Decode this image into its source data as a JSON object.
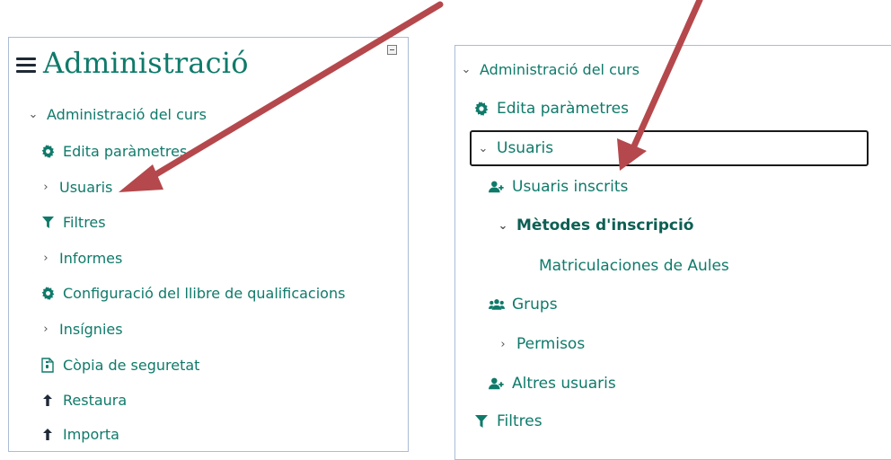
{
  "left_panel": {
    "title": "Administració",
    "items": [
      {
        "label": "Administració del curs",
        "icon": "chevron-down-icon"
      },
      {
        "label": "Edita paràmetres",
        "icon": "gear-icon"
      },
      {
        "label": "Usuaris",
        "icon": "chevron-right-icon"
      },
      {
        "label": "Filtres",
        "icon": "filter-icon"
      },
      {
        "label": "Informes",
        "icon": "chevron-right-icon"
      },
      {
        "label": "Configuració del llibre de qualificacions",
        "icon": "gear-icon"
      },
      {
        "label": "Insígnies",
        "icon": "chevron-right-icon"
      },
      {
        "label": "Còpia de seguretat",
        "icon": "file-archive-icon"
      },
      {
        "label": "Restaura",
        "icon": "upload-icon"
      },
      {
        "label": "Importa",
        "icon": "upload-icon"
      }
    ]
  },
  "right_panel": {
    "items": [
      {
        "label": "Administració del curs",
        "icon": "chevron-down-icon"
      },
      {
        "label": "Edita paràmetres",
        "icon": "gear-icon"
      },
      {
        "label": "Usuaris",
        "icon": "chevron-down-icon"
      },
      {
        "label": "Usuaris inscrits",
        "icon": "user-plus-icon"
      },
      {
        "label": "Mètodes d'inscripció",
        "icon": "chevron-down-icon"
      },
      {
        "label": "Matriculaciones de Aules",
        "icon": ""
      },
      {
        "label": "Grups",
        "icon": "users-icon"
      },
      {
        "label": "Permisos",
        "icon": "chevron-right-icon"
      },
      {
        "label": "Altres usuaris",
        "icon": "user-plus-icon"
      },
      {
        "label": "Filtres",
        "icon": "filter-icon"
      }
    ]
  },
  "colors": {
    "link": "#0f7a6a",
    "annotation_arrow": "#b5484c",
    "panel_border": "#a9bcd6"
  }
}
